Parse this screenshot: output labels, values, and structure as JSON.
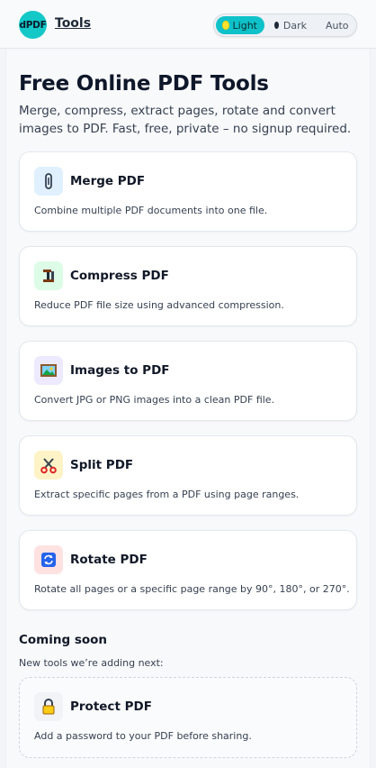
{
  "header": {
    "logo_text": "dPDF",
    "tools_link": "Tools",
    "theme": {
      "options": [
        {
          "label": "Light",
          "selected": true
        },
        {
          "label": "Dark",
          "selected": false
        },
        {
          "label": "Auto",
          "selected": false
        }
      ],
      "accent": "#0fc2c9"
    }
  },
  "main": {
    "title": "Free Online PDF Tools",
    "subtitle": "Merge, compress, extract pages, rotate and convert images to PDF. Fast, free, private – no signup required.",
    "tools": [
      {
        "title": "Merge PDF",
        "description": "Combine multiple PDF documents into one file.",
        "icon": "paperclip-icon",
        "icon_bg": "#e0f0ff"
      },
      {
        "title": "Compress PDF",
        "description": "Reduce PDF file size using advanced compression.",
        "icon": "clamp-icon",
        "icon_bg": "#dcfce7"
      },
      {
        "title": "Images to PDF",
        "description": "Convert JPG or PNG images into a clean PDF file.",
        "icon": "picture-icon",
        "icon_bg": "#ede9fe"
      },
      {
        "title": "Split PDF",
        "description": "Extract specific pages from a PDF using page ranges.",
        "icon": "scissors-icon",
        "icon_bg": "#fef3c7"
      },
      {
        "title": "Rotate PDF",
        "description": "Rotate all pages or a specific page range by 90°, 180°, or 270°.",
        "icon": "rotate-icon",
        "icon_bg": "#fee2e2"
      }
    ],
    "coming_soon": {
      "title": "Coming soon",
      "subtitle": "New tools we’re adding next:",
      "items": [
        {
          "title": "Protect PDF",
          "description": "Add a password to your PDF before sharing.",
          "icon": "lock-icon",
          "icon_bg": "#f1f3f6"
        }
      ]
    }
  }
}
